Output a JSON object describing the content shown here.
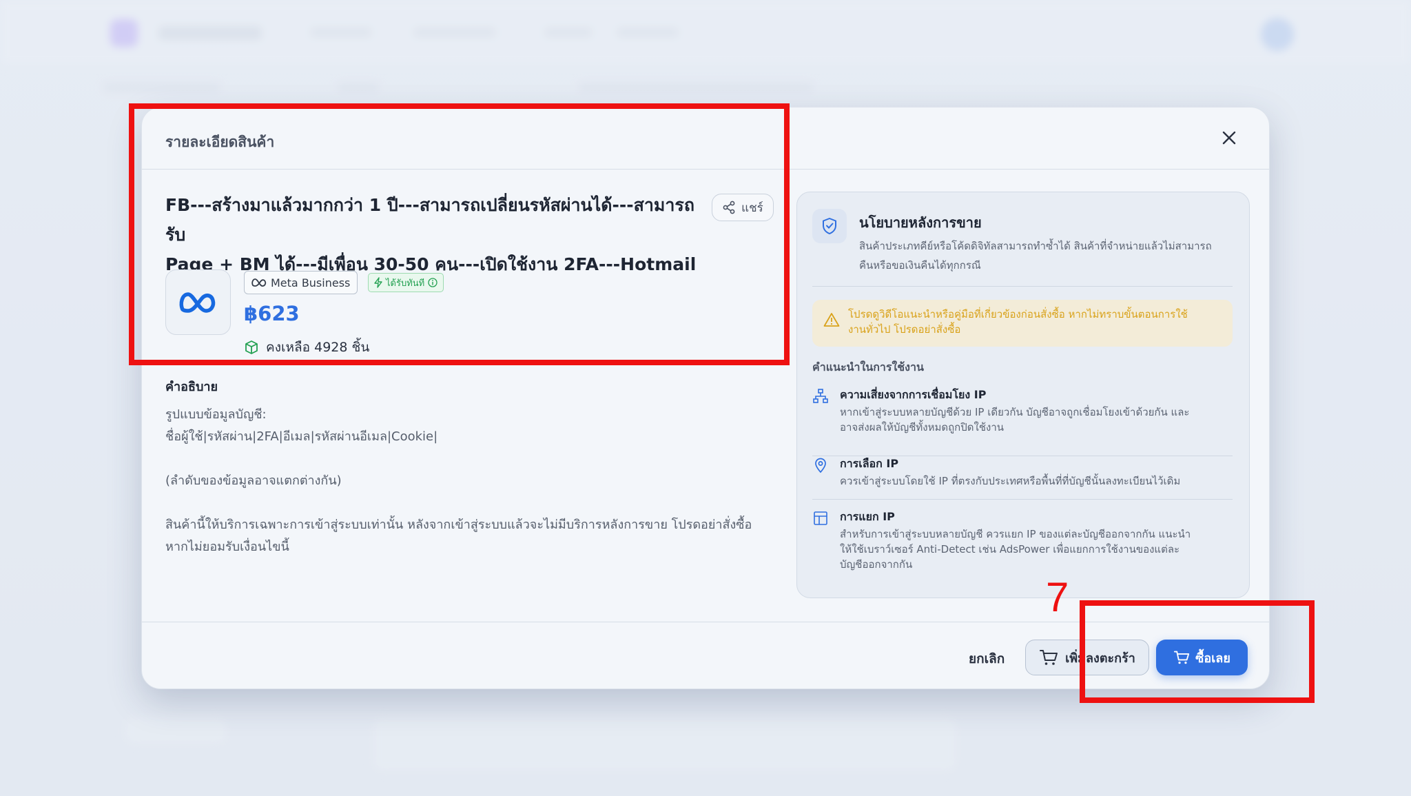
{
  "modal": {
    "header_title": "รายละเอียดสินค้า",
    "close_icon": "close-icon"
  },
  "product": {
    "title_line1": "FB---สร้างมาแล้วมากกว่า 1 ปี---สามารถเปลี่ยนรหัสผ่านได้---สามารถรับ",
    "title_line2": "Page + BM ได้---มีเพื่อน 30-50 คน---เปิดใช้งาน 2FA---Hotmail",
    "share_label": "แชร์",
    "logo_icon": "meta-logo-icon",
    "badge_brand": "Meta Business",
    "badge_instant": "ได้รับทันที",
    "price": "฿623",
    "stock_text": "คงเหลือ 4928 ชิ้น"
  },
  "description": {
    "heading": "คำอธิบาย",
    "line1": "รูปแบบข้อมูลบัญชี:",
    "line2": "ชื่อผู้ใช้|รหัสผ่าน|2FA|อีเมล|รหัสผ่านอีเมล|Cookie|",
    "line3": "(ลำดับของข้อมูลอาจแตกต่างกัน)",
    "line4": "สินค้านี้ให้บริการเฉพาะการเข้าสู่ระบบเท่านั้น หลังจากเข้าสู่ระบบแล้วจะไม่มีบริการหลังการขาย โปรดอย่าสั่งซื้อ",
    "line5": "หากไม่ยอมรับเงื่อนไขนี้"
  },
  "policy": {
    "title": "นโยบายหลังการขาย",
    "text_line1": "สินค้าประเภทคีย์หรือโค้ดดิจิทัลสามารถทำซ้ำได้ สินค้าที่จำหน่ายแล้วไม่สามารถ",
    "text_line2": "คืนหรือขอเงินคืนได้ทุกกรณี",
    "warning_line1": "โปรดดูวิดีโอแนะนำหรือคู่มือที่เกี่ยวข้องก่อนสั่งซื้อ หากไม่ทราบขั้นตอนการใช้",
    "warning_line2": "งานทั่วไป โปรดอย่าสั่งซื้อ",
    "tips_heading": "คำแนะนำในการใช้งาน",
    "tips": [
      {
        "title": "ความเสี่ยงจากการเชื่อมโยง IP",
        "line1": "หากเข้าสู่ระบบหลายบัญชีด้วย IP เดียวกัน บัญชีอาจถูกเชื่อมโยงเข้าด้วยกัน และ",
        "line2": "อาจส่งผลให้บัญชีทั้งหมดถูกปิดใช้งาน",
        "line3": ""
      },
      {
        "title": "การเลือก IP",
        "line1": "ควรเข้าสู่ระบบโดยใช้ IP ที่ตรงกับประเทศหรือพื้นที่ที่บัญชีนั้นลงทะเบียนไว้เดิม",
        "line2": "",
        "line3": ""
      },
      {
        "title": "การแยก IP",
        "line1": "สำหรับการเข้าสู่ระบบหลายบัญชี ควรแยก IP ของแต่ละบัญชีออกจากกัน แนะนำ",
        "line2": "ให้ใช้เบราว์เซอร์ Anti-Detect เช่น AdsPower เพื่อแยกการใช้งานของแต่ละ",
        "line3": "บัญชีออกจากกัน"
      }
    ]
  },
  "footer": {
    "cancel_label": "ยกเลิก",
    "add_to_cart_label": "เพิ่มลงตะกร้า",
    "buy_now_label": "ซื้อเลย"
  },
  "annotation": {
    "step_number": "7"
  },
  "colors": {
    "accent": "#2f6fe0",
    "annotation": "#ee1111",
    "instant_green": "#22a051",
    "warning": "#d9a21a"
  }
}
